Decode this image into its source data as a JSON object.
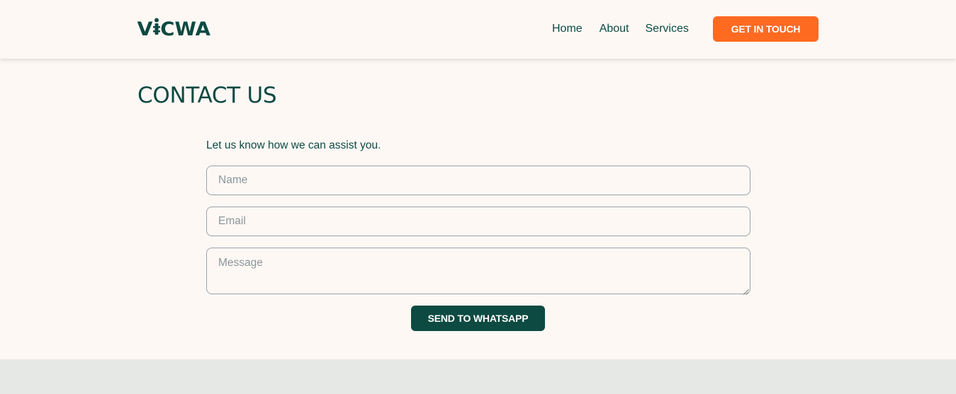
{
  "brand": {
    "logo_text_v": "V",
    "logo_text_rest": "CWA",
    "logo_aria": "VICWA"
  },
  "nav": {
    "items": [
      {
        "label": "Home"
      },
      {
        "label": "About"
      },
      {
        "label": "Services"
      }
    ],
    "cta_label": "GET IN TOUCH"
  },
  "contact": {
    "title": "CONTACT US",
    "intro": "Let us know how we can assist you.",
    "name_placeholder": "Name",
    "email_placeholder": "Email",
    "message_placeholder": "Message",
    "submit_label": "SEND TO WHATSAPP"
  },
  "colors": {
    "primary": "#0d4a42",
    "accent": "#ff6a21",
    "background": "#fef8f5",
    "footer": "#e6e8e5"
  },
  "icons": {
    "logo_i": "key-icon",
    "resize": "resize-grip-icon"
  }
}
